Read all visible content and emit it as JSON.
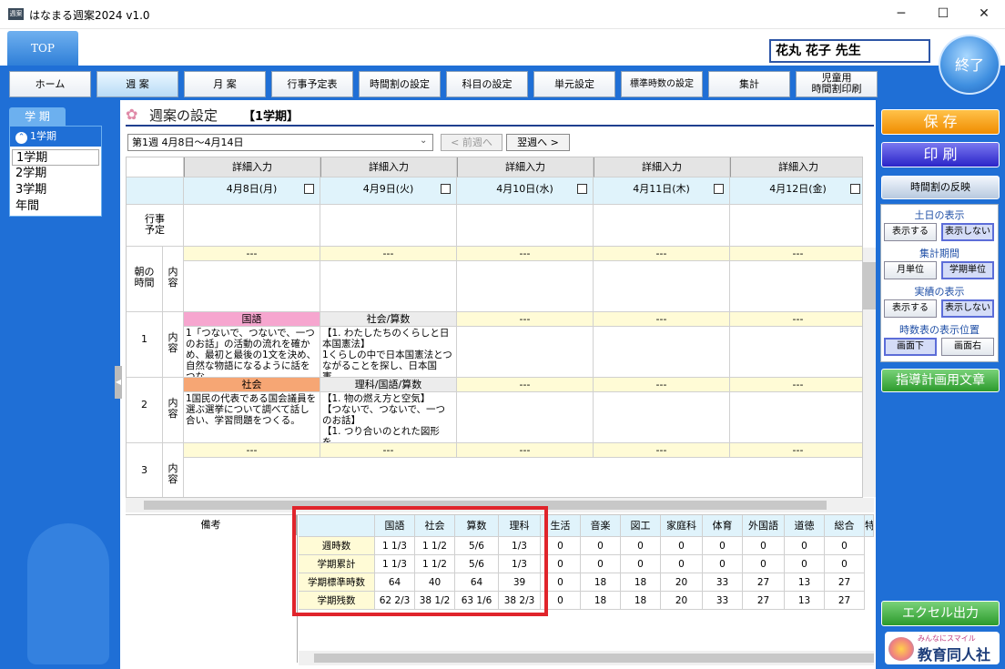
{
  "window": {
    "title": "はなまる週案2024 v1.0",
    "icon_label": "週案"
  },
  "header": {
    "top_tab": "TOP",
    "teacher": "花丸 花子 先生",
    "exit": "終了",
    "nav": [
      "ホーム",
      "週 案",
      "月 案",
      "行事予定表",
      "時間割の設定",
      "科目の設定",
      "単元設定",
      "標準時数の設定",
      "集計",
      "児童用\n時間割印刷"
    ],
    "active_nav": "週 案"
  },
  "left": {
    "header": "学 期",
    "selected": "1学期",
    "items": [
      "1学期",
      "2学期",
      "3学期",
      "年間"
    ]
  },
  "main": {
    "title": "週案の設定",
    "term": "【1学期】",
    "week_select": "第1週 4月8日〜4月14日",
    "prev_week": "< 前週へ",
    "next_week": "翌週へ >",
    "detail_label": "詳細入力",
    "dates": [
      "4月8日(月)",
      "4月9日(火)",
      "4月10日(水)",
      "4月11日(木)",
      "4月12日(金)"
    ],
    "row_labels": {
      "events": "行事\n予定",
      "morning": "朝の\n時間",
      "content": "内\n容",
      "p1": "1",
      "p2": "2",
      "p3": "3"
    },
    "empty": "---",
    "period1": {
      "mon_subject": "国語",
      "mon_text": "1「つないで、つないで、一つのお話」の活動の流れを確かめ、最初と最後の1文を決め、自然な物語になるように話をつな...",
      "tue_subject": "社会/算数",
      "tue_text": "【1. わたしたちのくらしと日本国憲法】\n1くらしの中で日本国憲法とつながることを探し、日本国憲..."
    },
    "period2": {
      "mon_subject": "社会",
      "mon_text": "1国民の代表である国会議員を選ぶ選挙について調べて話し合い、学習問題をつくる。",
      "tue_subject": "理科/国語/算数",
      "tue_text": "【1. 物の燃え方と空気】\n【つないで、つないで、一つのお話】\n【1. つり合いのとれた図形を..."
    }
  },
  "summary": {
    "remarks_label": "備考",
    "columns": [
      "国語",
      "社会",
      "算数",
      "理科",
      "生活",
      "音楽",
      "図工",
      "家庭科",
      "体育",
      "外国語",
      "道徳",
      "総合",
      "特"
    ],
    "rows": [
      {
        "label": "週時数",
        "values": [
          "1 1/3",
          "1 1/2",
          "5/6",
          "1/3",
          "0",
          "0",
          "0",
          "0",
          "0",
          "0",
          "0",
          "0"
        ]
      },
      {
        "label": "学期累計",
        "values": [
          "1 1/3",
          "1 1/2",
          "5/6",
          "1/3",
          "0",
          "0",
          "0",
          "0",
          "0",
          "0",
          "0",
          "0"
        ]
      },
      {
        "label": "学期標準時数",
        "values": [
          "64",
          "40",
          "64",
          "39",
          "0",
          "18",
          "18",
          "20",
          "33",
          "27",
          "13",
          "27"
        ]
      },
      {
        "label": "学期残数",
        "values": [
          "62 2/3",
          "38 1/2",
          "63 1/6",
          "38 2/3",
          "0",
          "18",
          "18",
          "20",
          "33",
          "27",
          "13",
          "27"
        ]
      }
    ]
  },
  "right": {
    "save": "保 存",
    "print": "印 刷",
    "reflect": "時間割の反映",
    "weekend_label": "土日の表示",
    "weekend_show": "表示する",
    "weekend_hide": "表示しない",
    "period_label": "集計期間",
    "period_month": "月単位",
    "period_term": "学期単位",
    "actual_label": "実績の表示",
    "actual_show": "表示する",
    "actual_hide": "表示しない",
    "pos_label": "時数表の表示位置",
    "pos_bottom": "画面下",
    "pos_right": "画面右",
    "guide": "指導計画用文章",
    "excel": "エクセル出力",
    "logo_sub": "みんなにスマイル",
    "logo_main": "教育同人社"
  },
  "colors": {
    "accent": "#1f6fd6",
    "highlight": "#e0242b",
    "subject_pink": "#f6a6cf",
    "subject_orange": "#f6a674"
  }
}
